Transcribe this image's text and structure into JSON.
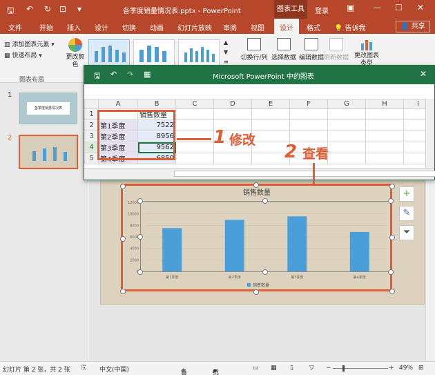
{
  "window": {
    "title": "各季度销量情况表.pptx - PowerPoint",
    "context_tab": "图表工具",
    "login": "登录",
    "controls": [
      "—",
      "☐",
      "✕"
    ]
  },
  "ribbon_tabs": [
    "文件",
    "开始",
    "插入",
    "设计",
    "切换",
    "动画",
    "幻灯片放映",
    "审阅",
    "视图",
    "设计",
    "格式"
  ],
  "active_tab": "设计",
  "tell_me": "告诉我",
  "share": "共享",
  "ribbon": {
    "add_chart_element": "添加图表元素",
    "quick_layout": "快速布局",
    "change_colors": "更改颜色",
    "group_chart_layouts": "图表布局",
    "switch_row_col": "切换行/列",
    "select_data": "选择数据",
    "edit_data": "编辑数据",
    "refresh_data": "刷新数据",
    "change_chart_type": "更改图表类型"
  },
  "slides": {
    "numbers": [
      "1",
      "2"
    ],
    "thumb1_title": "各季度销量情况表"
  },
  "excel": {
    "caption": "Microsoft PowerPoint 中的图表",
    "columns": [
      "A",
      "B",
      "C",
      "D",
      "E",
      "F",
      "G",
      "H",
      "I"
    ],
    "rows": [
      "1",
      "2",
      "3",
      "4",
      "5"
    ],
    "header": [
      "",
      "销售数量"
    ],
    "data": [
      [
        "第1季度",
        "7522"
      ],
      [
        "第2季度",
        "8956"
      ],
      [
        "第3季度",
        "9562"
      ],
      [
        "第4季度",
        "6850"
      ]
    ]
  },
  "annotations": {
    "step1_num": "1",
    "step1_text": "修改",
    "step2_num": "2",
    "step2_text": "查看"
  },
  "chart_data": {
    "type": "bar",
    "title": "销售数量",
    "categories": [
      "第1季度",
      "第2季度",
      "第3季度",
      "第4季度"
    ],
    "series": [
      {
        "name": "销售数量",
        "values": [
          7522,
          8956,
          9562,
          6850
        ]
      }
    ],
    "y_ticks": [
      "0",
      "2000",
      "4000",
      "6000",
      "8000",
      "10000",
      "12000"
    ],
    "ylim": [
      0,
      12000
    ],
    "legend": "bottom",
    "bar_color": "#4a9fd8"
  },
  "statusbar": {
    "slide_info": "幻灯片 第 2 张，共 2 张",
    "language": "中文(中国)",
    "notes": "备注",
    "comments": "批注",
    "zoom": "49%"
  },
  "colors": {
    "powerpoint_accent": "#b7472a",
    "excel_accent": "#217346",
    "annotation": "#e05d33"
  }
}
